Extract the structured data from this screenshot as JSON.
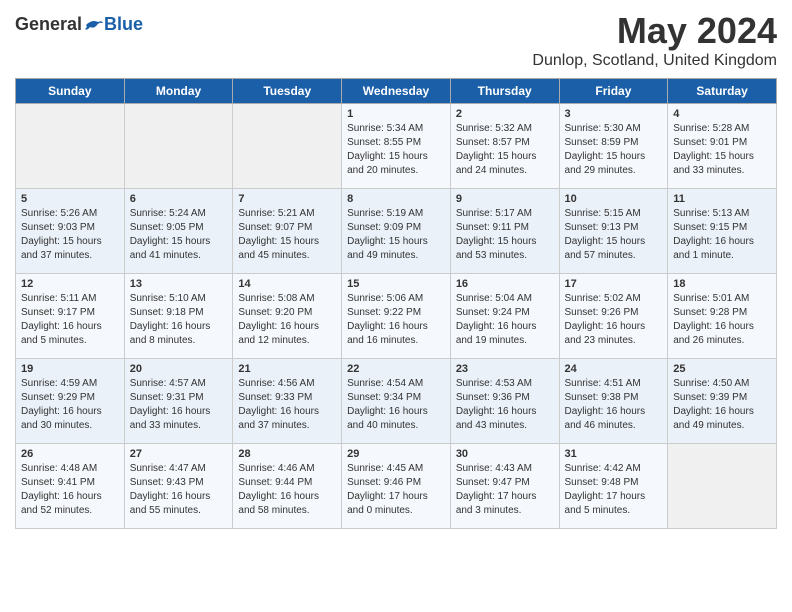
{
  "app": {
    "name_general": "General",
    "name_blue": "Blue",
    "month": "May 2024",
    "location": "Dunlop, Scotland, United Kingdom"
  },
  "calendar": {
    "headers": [
      "Sunday",
      "Monday",
      "Tuesday",
      "Wednesday",
      "Thursday",
      "Friday",
      "Saturday"
    ],
    "rows": [
      [
        {
          "day": "",
          "text": ""
        },
        {
          "day": "",
          "text": ""
        },
        {
          "day": "",
          "text": ""
        },
        {
          "day": "1",
          "text": "Sunrise: 5:34 AM\nSunset: 8:55 PM\nDaylight: 15 hours\nand 20 minutes."
        },
        {
          "day": "2",
          "text": "Sunrise: 5:32 AM\nSunset: 8:57 PM\nDaylight: 15 hours\nand 24 minutes."
        },
        {
          "day": "3",
          "text": "Sunrise: 5:30 AM\nSunset: 8:59 PM\nDaylight: 15 hours\nand 29 minutes."
        },
        {
          "day": "4",
          "text": "Sunrise: 5:28 AM\nSunset: 9:01 PM\nDaylight: 15 hours\nand 33 minutes."
        }
      ],
      [
        {
          "day": "5",
          "text": "Sunrise: 5:26 AM\nSunset: 9:03 PM\nDaylight: 15 hours\nand 37 minutes."
        },
        {
          "day": "6",
          "text": "Sunrise: 5:24 AM\nSunset: 9:05 PM\nDaylight: 15 hours\nand 41 minutes."
        },
        {
          "day": "7",
          "text": "Sunrise: 5:21 AM\nSunset: 9:07 PM\nDaylight: 15 hours\nand 45 minutes."
        },
        {
          "day": "8",
          "text": "Sunrise: 5:19 AM\nSunset: 9:09 PM\nDaylight: 15 hours\nand 49 minutes."
        },
        {
          "day": "9",
          "text": "Sunrise: 5:17 AM\nSunset: 9:11 PM\nDaylight: 15 hours\nand 53 minutes."
        },
        {
          "day": "10",
          "text": "Sunrise: 5:15 AM\nSunset: 9:13 PM\nDaylight: 15 hours\nand 57 minutes."
        },
        {
          "day": "11",
          "text": "Sunrise: 5:13 AM\nSunset: 9:15 PM\nDaylight: 16 hours\nand 1 minute."
        }
      ],
      [
        {
          "day": "12",
          "text": "Sunrise: 5:11 AM\nSunset: 9:17 PM\nDaylight: 16 hours\nand 5 minutes."
        },
        {
          "day": "13",
          "text": "Sunrise: 5:10 AM\nSunset: 9:18 PM\nDaylight: 16 hours\nand 8 minutes."
        },
        {
          "day": "14",
          "text": "Sunrise: 5:08 AM\nSunset: 9:20 PM\nDaylight: 16 hours\nand 12 minutes."
        },
        {
          "day": "15",
          "text": "Sunrise: 5:06 AM\nSunset: 9:22 PM\nDaylight: 16 hours\nand 16 minutes."
        },
        {
          "day": "16",
          "text": "Sunrise: 5:04 AM\nSunset: 9:24 PM\nDaylight: 16 hours\nand 19 minutes."
        },
        {
          "day": "17",
          "text": "Sunrise: 5:02 AM\nSunset: 9:26 PM\nDaylight: 16 hours\nand 23 minutes."
        },
        {
          "day": "18",
          "text": "Sunrise: 5:01 AM\nSunset: 9:28 PM\nDaylight: 16 hours\nand 26 minutes."
        }
      ],
      [
        {
          "day": "19",
          "text": "Sunrise: 4:59 AM\nSunset: 9:29 PM\nDaylight: 16 hours\nand 30 minutes."
        },
        {
          "day": "20",
          "text": "Sunrise: 4:57 AM\nSunset: 9:31 PM\nDaylight: 16 hours\nand 33 minutes."
        },
        {
          "day": "21",
          "text": "Sunrise: 4:56 AM\nSunset: 9:33 PM\nDaylight: 16 hours\nand 37 minutes."
        },
        {
          "day": "22",
          "text": "Sunrise: 4:54 AM\nSunset: 9:34 PM\nDaylight: 16 hours\nand 40 minutes."
        },
        {
          "day": "23",
          "text": "Sunrise: 4:53 AM\nSunset: 9:36 PM\nDaylight: 16 hours\nand 43 minutes."
        },
        {
          "day": "24",
          "text": "Sunrise: 4:51 AM\nSunset: 9:38 PM\nDaylight: 16 hours\nand 46 minutes."
        },
        {
          "day": "25",
          "text": "Sunrise: 4:50 AM\nSunset: 9:39 PM\nDaylight: 16 hours\nand 49 minutes."
        }
      ],
      [
        {
          "day": "26",
          "text": "Sunrise: 4:48 AM\nSunset: 9:41 PM\nDaylight: 16 hours\nand 52 minutes."
        },
        {
          "day": "27",
          "text": "Sunrise: 4:47 AM\nSunset: 9:43 PM\nDaylight: 16 hours\nand 55 minutes."
        },
        {
          "day": "28",
          "text": "Sunrise: 4:46 AM\nSunset: 9:44 PM\nDaylight: 16 hours\nand 58 minutes."
        },
        {
          "day": "29",
          "text": "Sunrise: 4:45 AM\nSunset: 9:46 PM\nDaylight: 17 hours\nand 0 minutes."
        },
        {
          "day": "30",
          "text": "Sunrise: 4:43 AM\nSunset: 9:47 PM\nDaylight: 17 hours\nand 3 minutes."
        },
        {
          "day": "31",
          "text": "Sunrise: 4:42 AM\nSunset: 9:48 PM\nDaylight: 17 hours\nand 5 minutes."
        },
        {
          "day": "",
          "text": ""
        }
      ]
    ]
  }
}
